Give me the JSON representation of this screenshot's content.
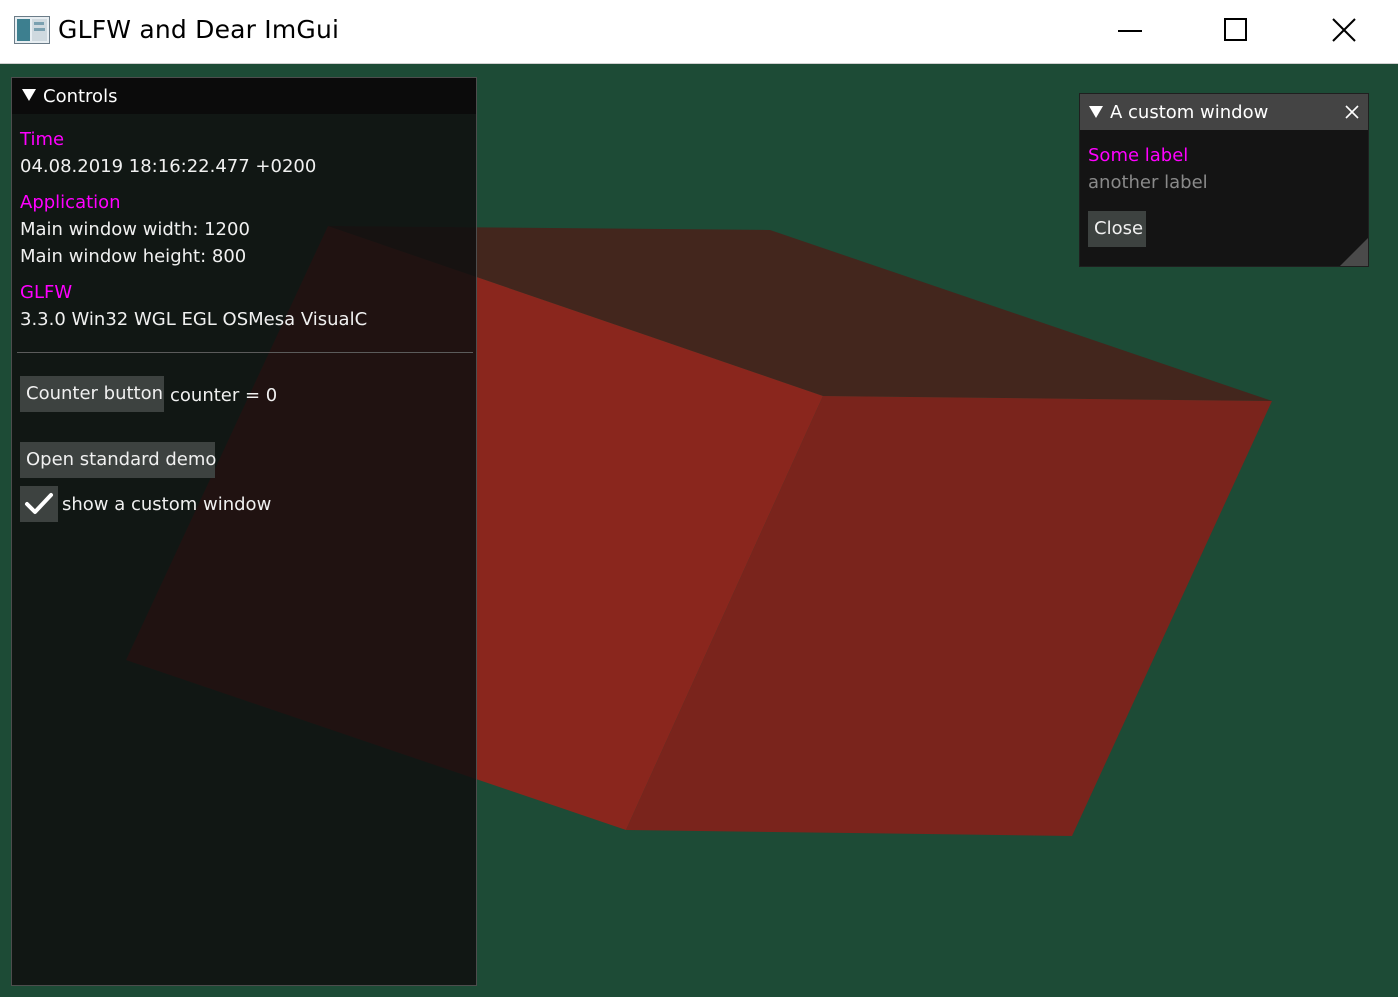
{
  "titlebar": {
    "title": "GLFW and Dear ImGui",
    "icons": [
      "app-icon",
      "minimize-icon",
      "maximize-icon",
      "close-icon"
    ]
  },
  "controls": {
    "title": "Controls",
    "time_header": "Time",
    "time_value": "04.08.2019 18:16:22.477 +0200",
    "application_header": "Application",
    "main_window_width": "Main window width: 1200",
    "main_window_height": "Main window height: 800",
    "glfw_header": "GLFW",
    "glfw_version": "3.3.0 Win32 WGL EGL OSMesa VisualC",
    "counter_button": "Counter button",
    "counter_text": "counter = 0",
    "open_demo_button": "Open standard demo",
    "custom_window_checkbox": {
      "label": "show a custom window",
      "checked": true
    }
  },
  "custom_window": {
    "title": "A custom window",
    "some_label": "Some label",
    "another_label": "another label",
    "close_button": "Close"
  },
  "colors": {
    "background": "#1d4b36",
    "accent_label": "#ff00ff",
    "cube_face_light": "#8a261d",
    "cube_face_dark": "#7a241c",
    "cube_top": "#43261d"
  }
}
